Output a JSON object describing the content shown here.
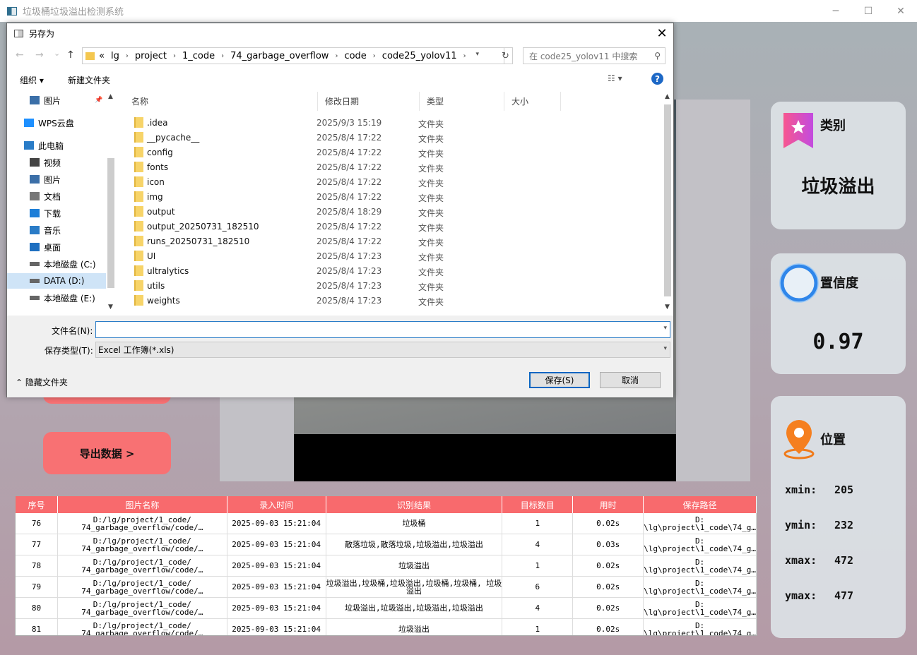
{
  "main_window": {
    "title": "垃圾桶垃圾溢出检测系统"
  },
  "window_controls": {
    "minimize": "─",
    "maximize": "☐",
    "close": "✕"
  },
  "category_card": {
    "label": "类别",
    "value": "垃圾溢出",
    "accent": "#e9568a"
  },
  "confidence_card": {
    "label": "置信度",
    "value": "0.97",
    "accent": "#3b8fe6"
  },
  "position_card": {
    "label": "位置",
    "xmin_label": "xmin:",
    "xmin": "205",
    "ymin_label": "ymin:",
    "ymin": "232",
    "xmax_label": "xmax:",
    "xmax": "472",
    "ymax_label": "ymax:",
    "ymax": "477",
    "accent": "#f07a1a"
  },
  "export_button": {
    "label": "导出数据 >"
  },
  "table": {
    "headers": [
      "序号",
      "图片名称",
      "录入时间",
      "识别结果",
      "目标数目",
      "用时",
      "保存路径"
    ],
    "rows": [
      {
        "id": "76",
        "name": "D:/lg/project/1_code/ 74_garbage_overflow/code/…",
        "time": "2025-09-03 15:21:04",
        "result": "垃圾桶",
        "count": "1",
        "cost": "0.02s",
        "path": "D: \\lg\\project\\1_code\\74_g…"
      },
      {
        "id": "77",
        "name": "D:/lg/project/1_code/ 74_garbage_overflow/code/…",
        "time": "2025-09-03 15:21:04",
        "result": "散落垃圾,散落垃圾,垃圾溢出,垃圾溢出",
        "count": "4",
        "cost": "0.03s",
        "path": "D: \\lg\\project\\1_code\\74_g…"
      },
      {
        "id": "78",
        "name": "D:/lg/project/1_code/ 74_garbage_overflow/code/…",
        "time": "2025-09-03 15:21:04",
        "result": "垃圾溢出",
        "count": "1",
        "cost": "0.02s",
        "path": "D: \\lg\\project\\1_code\\74_g…"
      },
      {
        "id": "79",
        "name": "D:/lg/project/1_code/ 74_garbage_overflow/code/…",
        "time": "2025-09-03 15:21:04",
        "result": "垃圾溢出,垃圾桶,垃圾溢出,垃圾桶,垃圾桶, 垃圾溢出",
        "count": "6",
        "cost": "0.02s",
        "path": "D: \\lg\\project\\1_code\\74_g…"
      },
      {
        "id": "80",
        "name": "D:/lg/project/1_code/ 74_garbage_overflow/code/…",
        "time": "2025-09-03 15:21:04",
        "result": "垃圾溢出,垃圾溢出,垃圾溢出,垃圾溢出",
        "count": "4",
        "cost": "0.02s",
        "path": "D: \\lg\\project\\1_code\\74_g…"
      },
      {
        "id": "81",
        "name": "D:/lg/project/1_code/ 74_garbage_overflow/code/…",
        "time": "2025-09-03 15:21:04",
        "result": "垃圾溢出",
        "count": "1",
        "cost": "0.02s",
        "path": "D: \\lg\\project\\1_code\\74_g…"
      }
    ]
  },
  "dialog": {
    "title": "另存为",
    "close": "✕",
    "nav": {
      "back": "←",
      "forward": "→",
      "recent": "⌄",
      "up": "↑",
      "refresh": "↻"
    },
    "breadcrumb": [
      "«",
      "lg",
      "project",
      "1_code",
      "74_garbage_overflow",
      "code",
      "code25_yolov11"
    ],
    "breadcrumb_sep": "›",
    "search_placeholder": "在 code25_yolov11 中搜索",
    "toolbar": {
      "organize": "组织 ▾",
      "new_folder": "新建文件夹",
      "view": "☷ ▾",
      "help": "?"
    },
    "sidebar": [
      {
        "label": "图片",
        "icon": "pictures-icon"
      },
      {
        "label": "WPS云盘",
        "icon": "cloud-icon"
      },
      {
        "label": "此电脑",
        "icon": "computer-icon"
      },
      {
        "label": "视频",
        "icon": "video-icon"
      },
      {
        "label": "图片",
        "icon": "pictures-icon"
      },
      {
        "label": "文档",
        "icon": "document-icon"
      },
      {
        "label": "下载",
        "icon": "download-icon"
      },
      {
        "label": "音乐",
        "icon": "music-icon"
      },
      {
        "label": "桌面",
        "icon": "desktop-icon"
      },
      {
        "label": "本地磁盘 (C:)",
        "icon": "drive-icon"
      },
      {
        "label": "DATA (D:)",
        "icon": "drive-icon"
      },
      {
        "label": "本地磁盘 (E:)",
        "icon": "drive-icon"
      }
    ],
    "columns": {
      "name": "名称",
      "date": "修改日期",
      "type": "类型",
      "size": "大小"
    },
    "files": [
      {
        "name": ".idea",
        "date": "2025/9/3 15:19",
        "type": "文件夹"
      },
      {
        "name": "__pycache__",
        "date": "2025/8/4 17:22",
        "type": "文件夹"
      },
      {
        "name": "config",
        "date": "2025/8/4 17:22",
        "type": "文件夹"
      },
      {
        "name": "fonts",
        "date": "2025/8/4 17:22",
        "type": "文件夹"
      },
      {
        "name": "icon",
        "date": "2025/8/4 17:22",
        "type": "文件夹"
      },
      {
        "name": "img",
        "date": "2025/8/4 17:22",
        "type": "文件夹"
      },
      {
        "name": "output",
        "date": "2025/8/4 18:29",
        "type": "文件夹"
      },
      {
        "name": "output_20250731_182510",
        "date": "2025/8/4 17:22",
        "type": "文件夹"
      },
      {
        "name": "runs_20250731_182510",
        "date": "2025/8/4 17:22",
        "type": "文件夹"
      },
      {
        "name": "UI",
        "date": "2025/8/4 17:23",
        "type": "文件夹"
      },
      {
        "name": "ultralytics",
        "date": "2025/8/4 17:23",
        "type": "文件夹"
      },
      {
        "name": "utils",
        "date": "2025/8/4 17:23",
        "type": "文件夹"
      },
      {
        "name": "weights",
        "date": "2025/8/4 17:23",
        "type": "文件夹"
      }
    ],
    "filename_label": "文件名(N):",
    "filename_value": "",
    "filetype_label": "保存类型(T):",
    "filetype_value": "Excel 工作簿(*.xls)",
    "hide_folders": "隐藏文件夹",
    "save_button": "保存(S)",
    "cancel_button": "取消"
  }
}
